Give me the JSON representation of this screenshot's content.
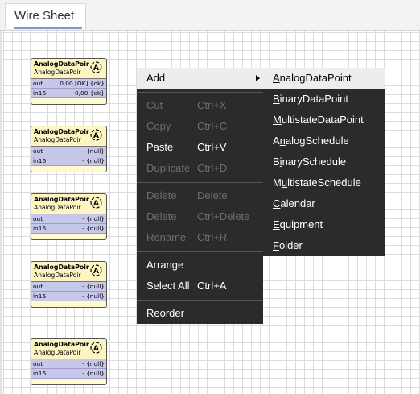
{
  "tab": {
    "label": "Wire Sheet"
  },
  "blocks": [
    {
      "title": "AnalogDataPoir",
      "subtitle": "AnalogDataPoir",
      "icon": "analog-point-icon",
      "slots": [
        {
          "name": "out",
          "value": "0,00 [OK] {ok}"
        },
        {
          "name": "in16",
          "value": "0,00 {ok}"
        }
      ]
    },
    {
      "title": "AnalogDataPoir",
      "subtitle": "AnalogDataPoir",
      "icon": "analog-point-icon",
      "slots": [
        {
          "name": "out",
          "value": "- {null}"
        },
        {
          "name": "in16",
          "value": "- {null}"
        }
      ]
    },
    {
      "title": "AnalogDataPoir",
      "subtitle": "AnalogDataPoir",
      "icon": "analog-point-icon",
      "slots": [
        {
          "name": "out",
          "value": "- {null}"
        },
        {
          "name": "in16",
          "value": "- {null}"
        }
      ]
    },
    {
      "title": "AnalogDataPoir",
      "subtitle": "AnalogDataPoir",
      "icon": "analog-point-icon",
      "slots": [
        {
          "name": "out",
          "value": "- {null}"
        },
        {
          "name": "in16",
          "value": "- {null}"
        }
      ]
    },
    {
      "title": "AnalogDataPoir",
      "subtitle": "AnalogDataPoir",
      "icon": "analog-point-icon",
      "slots": [
        {
          "name": "out",
          "value": "- {null}"
        },
        {
          "name": "in16",
          "value": "- {null}"
        }
      ]
    }
  ],
  "context_menu": {
    "items": [
      {
        "label": "Add",
        "shortcut": "",
        "enabled": true,
        "has_submenu": true
      },
      {
        "label": "Cut",
        "shortcut": "Ctrl+X",
        "enabled": false
      },
      {
        "label": "Copy",
        "shortcut": "Ctrl+C",
        "enabled": false
      },
      {
        "label": "Paste",
        "shortcut": "Ctrl+V",
        "enabled": true
      },
      {
        "label": "Duplicate",
        "shortcut": "Ctrl+D",
        "enabled": false
      },
      {
        "label": "Delete",
        "shortcut": "Delete",
        "enabled": false
      },
      {
        "label": "Delete",
        "shortcut": "Ctrl+Delete",
        "enabled": false
      },
      {
        "label": "Rename",
        "shortcut": "Ctrl+R",
        "enabled": false
      },
      {
        "label": "Arrange",
        "shortcut": "",
        "enabled": true
      },
      {
        "label": "Select All",
        "shortcut": "Ctrl+A",
        "enabled": true
      },
      {
        "label": "Reorder",
        "shortcut": "",
        "enabled": true
      }
    ]
  },
  "add_submenu": {
    "items": [
      {
        "label": "AnalogDataPoint",
        "mnemonic": "A"
      },
      {
        "label": "BinaryDataPoint",
        "mnemonic": "B"
      },
      {
        "label": "MultistateDataPoint",
        "mnemonic": "M"
      },
      {
        "label": "AnalogSchedule",
        "mnemonic": "n"
      },
      {
        "label": "BinarySchedule",
        "mnemonic": "i"
      },
      {
        "label": "MultistateSchedule",
        "mnemonic": "u"
      },
      {
        "label": "Calendar",
        "mnemonic": "C"
      },
      {
        "label": "Equipment",
        "mnemonic": "E"
      },
      {
        "label": "Folder",
        "mnemonic": "F"
      }
    ]
  },
  "colors": {
    "menu_bg": "#2b2b2b",
    "menu_hover": "#ededed",
    "block_body": "#fffacd",
    "slot_bg": "#c7c7ea",
    "tab_underline": "#7b9ccc"
  }
}
